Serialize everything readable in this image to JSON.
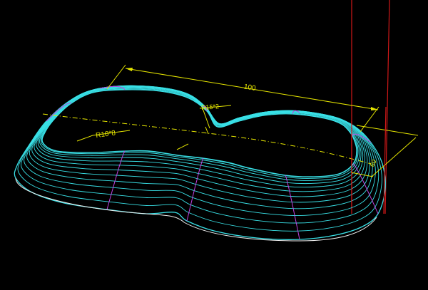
{
  "viewport": {
    "background": "#000000",
    "colors": {
      "toolpath": "#39e0e6",
      "section": "#c040e0",
      "dimension": "#e6e600",
      "axis": "#d01818",
      "bottom_edge": "#f0f0f0"
    }
  },
  "dimensions": {
    "length": "100",
    "upper_radius": "R15*2",
    "lower_radius": "R10*8",
    "side": "60"
  }
}
